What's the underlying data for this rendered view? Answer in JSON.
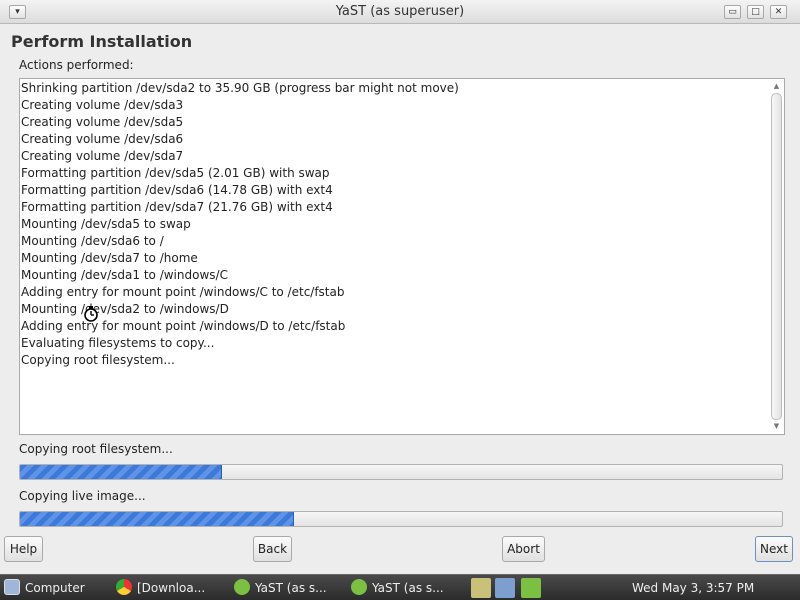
{
  "window": {
    "title": "YaST (as superuser)",
    "menu_glyph": "▾",
    "min_glyph": "▭",
    "max_glyph": "□",
    "close_glyph": "✕"
  },
  "page": {
    "heading": "Perform Installation",
    "actions_label": "Actions performed:"
  },
  "log_lines": [
    "Shrinking partition /dev/sda2 to 35.90 GB (progress bar might not move)",
    "Creating volume /dev/sda3",
    "Creating volume /dev/sda5",
    "Creating volume /dev/sda6",
    "Creating volume /dev/sda7",
    "Formatting partition /dev/sda5 (2.01 GB) with swap",
    "Formatting partition /dev/sda6 (14.78 GB) with ext4",
    "Formatting partition /dev/sda7 (21.76 GB) with ext4",
    "Mounting /dev/sda5 to swap",
    "Mounting /dev/sda6 to /",
    "Mounting /dev/sda7 to /home",
    "Mounting /dev/sda1 to /windows/C",
    "Adding entry for mount point /windows/C to /etc/fstab",
    "Mounting /dev/sda2 to /windows/D",
    "Adding entry for mount point /windows/D to /etc/fstab",
    "Evaluating filesystems to copy...",
    "Copying root filesystem..."
  ],
  "progress": {
    "step_label": "Copying root filesystem...",
    "step_fraction": 0.265,
    "overall_label": "Copying live image...",
    "overall_fraction": 0.36
  },
  "buttons": {
    "help": "Help",
    "back": "Back",
    "abort": "Abort",
    "next": "Next"
  },
  "taskbar": {
    "computer": "Computer",
    "downloads": "[Downloa...",
    "yast1": "YaST (as s...",
    "yast2": "YaST (as s...",
    "clock": "Wed May  3,  3:57 PM"
  },
  "colors": {
    "progress_fill": "#3d79d8",
    "taskbar_bg": "#2b2b2b"
  }
}
